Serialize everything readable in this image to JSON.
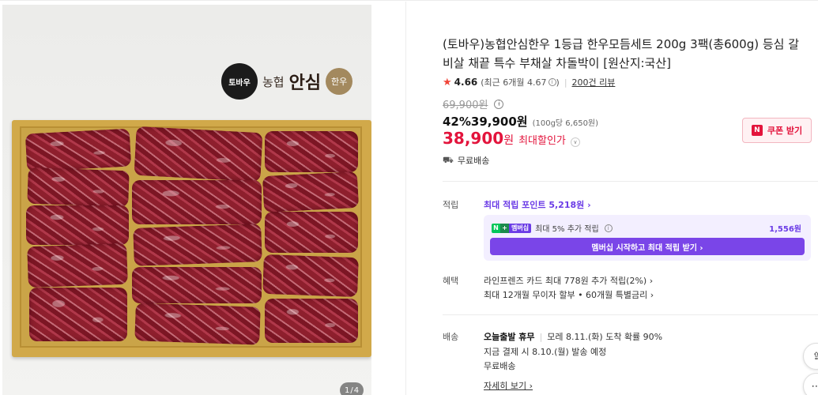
{
  "gallery": {
    "brand_logo_text": "토바우",
    "brand_prefix": "농협",
    "brand_main": "안심",
    "brand_badge": "한우",
    "counter_current": "1",
    "counter_sep": "/",
    "counter_total": "4"
  },
  "product": {
    "title": "(토바우)농협안심한우 1등급 한우모듬세트 200g 3팩(총600g) 등심 갈비살 채끝 특수 부채살 차돌박이 [원산지:국산]",
    "rating": "4.66",
    "rating_recent": "(최근 6개월 4.67",
    "rating_recent_close": ")",
    "review_count": "200건 리뷰",
    "original_price": "69,900원",
    "discount_rate": "42%",
    "sale_price": "39,900원",
    "unit_price": "(100g당 6,650원)",
    "max_discount_price": "38,900",
    "max_discount_currency": "원",
    "max_discount_label": "최대할인가",
    "coupon_label": "쿠폰 받기",
    "shipping_short": "무료배송"
  },
  "points": {
    "label": "적립",
    "max_points_link": "최대 적립 포인트 5,218원 ›",
    "membership_badge": "멤버십",
    "membership_text": "최대 5% 추가 적립",
    "membership_amount": "1,556원",
    "membership_button": "멤버십 시작하고 최대 적립 받기 ›"
  },
  "benefits": {
    "label": "혜택",
    "card": "라인프렌즈 카드 최대 778원 추가 적립(2%) ›",
    "installment": "최대 12개월 무이자 할부 • 60개월 특별금리 ›"
  },
  "shipping": {
    "label": "배송",
    "holiday": "오늘출발 휴무",
    "arrival": "모레 8.11.(화) 도착 확률 90%",
    "dispatch": "지금 결제 시 8.10.(월) 발송 예정",
    "fee": "무료배송",
    "more_link": "자세히 보기 ›"
  },
  "icons": {
    "star": "star-icon",
    "truck": "truck-icon",
    "info": "info-icon",
    "share": "share-icon",
    "more": "more-icon"
  },
  "colors": {
    "accent_red": "#e3143c",
    "accent_purple": "#6b3ce6",
    "naver_green": "#03c75a"
  }
}
